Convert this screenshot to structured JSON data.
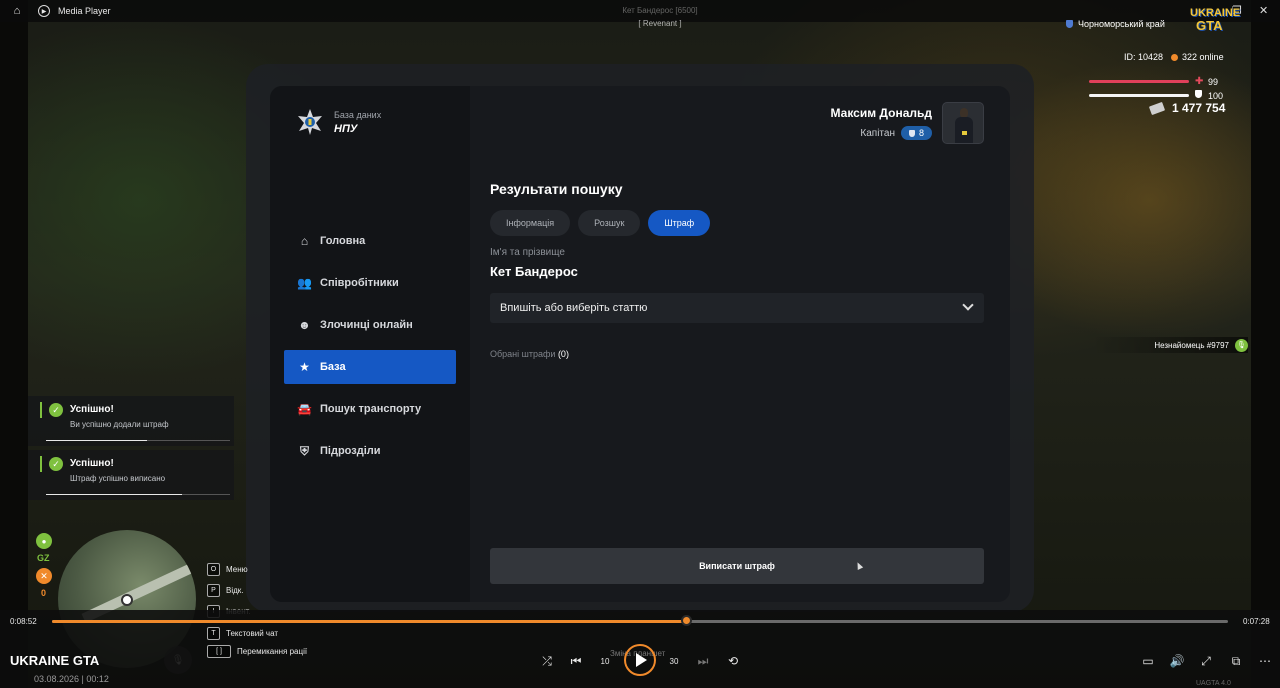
{
  "player": {
    "app_title": "Media Player",
    "video_title": "UKRAINE GTA",
    "date": "03.08.2026 | 00:12",
    "time_elapsed": "0:08:52",
    "time_remaining": "0:07:28",
    "progress_fraction": 0.54,
    "skip_back": "10",
    "skip_forward": "30",
    "watermark": "UAGTA 4.0"
  },
  "hud": {
    "target_name": "Кет Бандерос [6500]",
    "target_sub": "[ Revenant ]",
    "region": "Чорноморський край",
    "logo_top": "UKRAINE",
    "logo_bottom": "GTA",
    "player_id": "ID: 10428",
    "online": "322 online",
    "health": "99",
    "armor": "100",
    "money": "1 477 754",
    "stranger": "Незнайомець #9797",
    "gz_label": "GZ",
    "x_label": "0",
    "keys": [
      {
        "key": "O",
        "label": "Меню"
      },
      {
        "key": "P",
        "label": "Відк."
      },
      {
        "key": "I",
        "label": "Інвент."
      },
      {
        "key": "T",
        "label": "Текстовий чат"
      },
      {
        "key": "[ ]",
        "label": "Перемикання рації"
      }
    ],
    "bottom_key_hint": "Зміна планшет"
  },
  "notifications": [
    {
      "title": "Успішно!",
      "message": "Ви успішно додали штраф",
      "progress": 0.55
    },
    {
      "title": "Успішно!",
      "message": "Штраф успішно виписано",
      "progress": 0.74
    }
  ],
  "panel": {
    "brand_sub": "База даних",
    "brand_name": "НПУ",
    "user_name": "Максим Дональд",
    "user_rank": "Капітан",
    "rank_level": "8",
    "nav": [
      {
        "label": "Головна",
        "icon": "home-icon"
      },
      {
        "label": "Співробітники",
        "icon": "users-icon"
      },
      {
        "label": "Злочинці онлайн",
        "icon": "criminal-icon"
      },
      {
        "label": "База",
        "icon": "star-icon",
        "active": true
      },
      {
        "label": "Пошук транспорту",
        "icon": "car-icon"
      },
      {
        "label": "Підрозділи",
        "icon": "shield-icon"
      }
    ],
    "heading": "Результати пошуку",
    "tabs": [
      {
        "label": "Інформація"
      },
      {
        "label": "Розшук"
      },
      {
        "label": "Штраф",
        "active": true
      }
    ],
    "field_label": "Ім'я та прізвище",
    "field_value": "Кет Бандерос",
    "select_placeholder": "Впишіть або виберіть статтю",
    "chosen_label": "Обрані штрафи",
    "chosen_count": "(0)",
    "issue_button": "Виписати штраф"
  },
  "colors": {
    "accent_blue": "#1558c4",
    "accent_orange": "#f08a2b",
    "success_green": "#7fc13f",
    "health_red": "#e0405a"
  }
}
